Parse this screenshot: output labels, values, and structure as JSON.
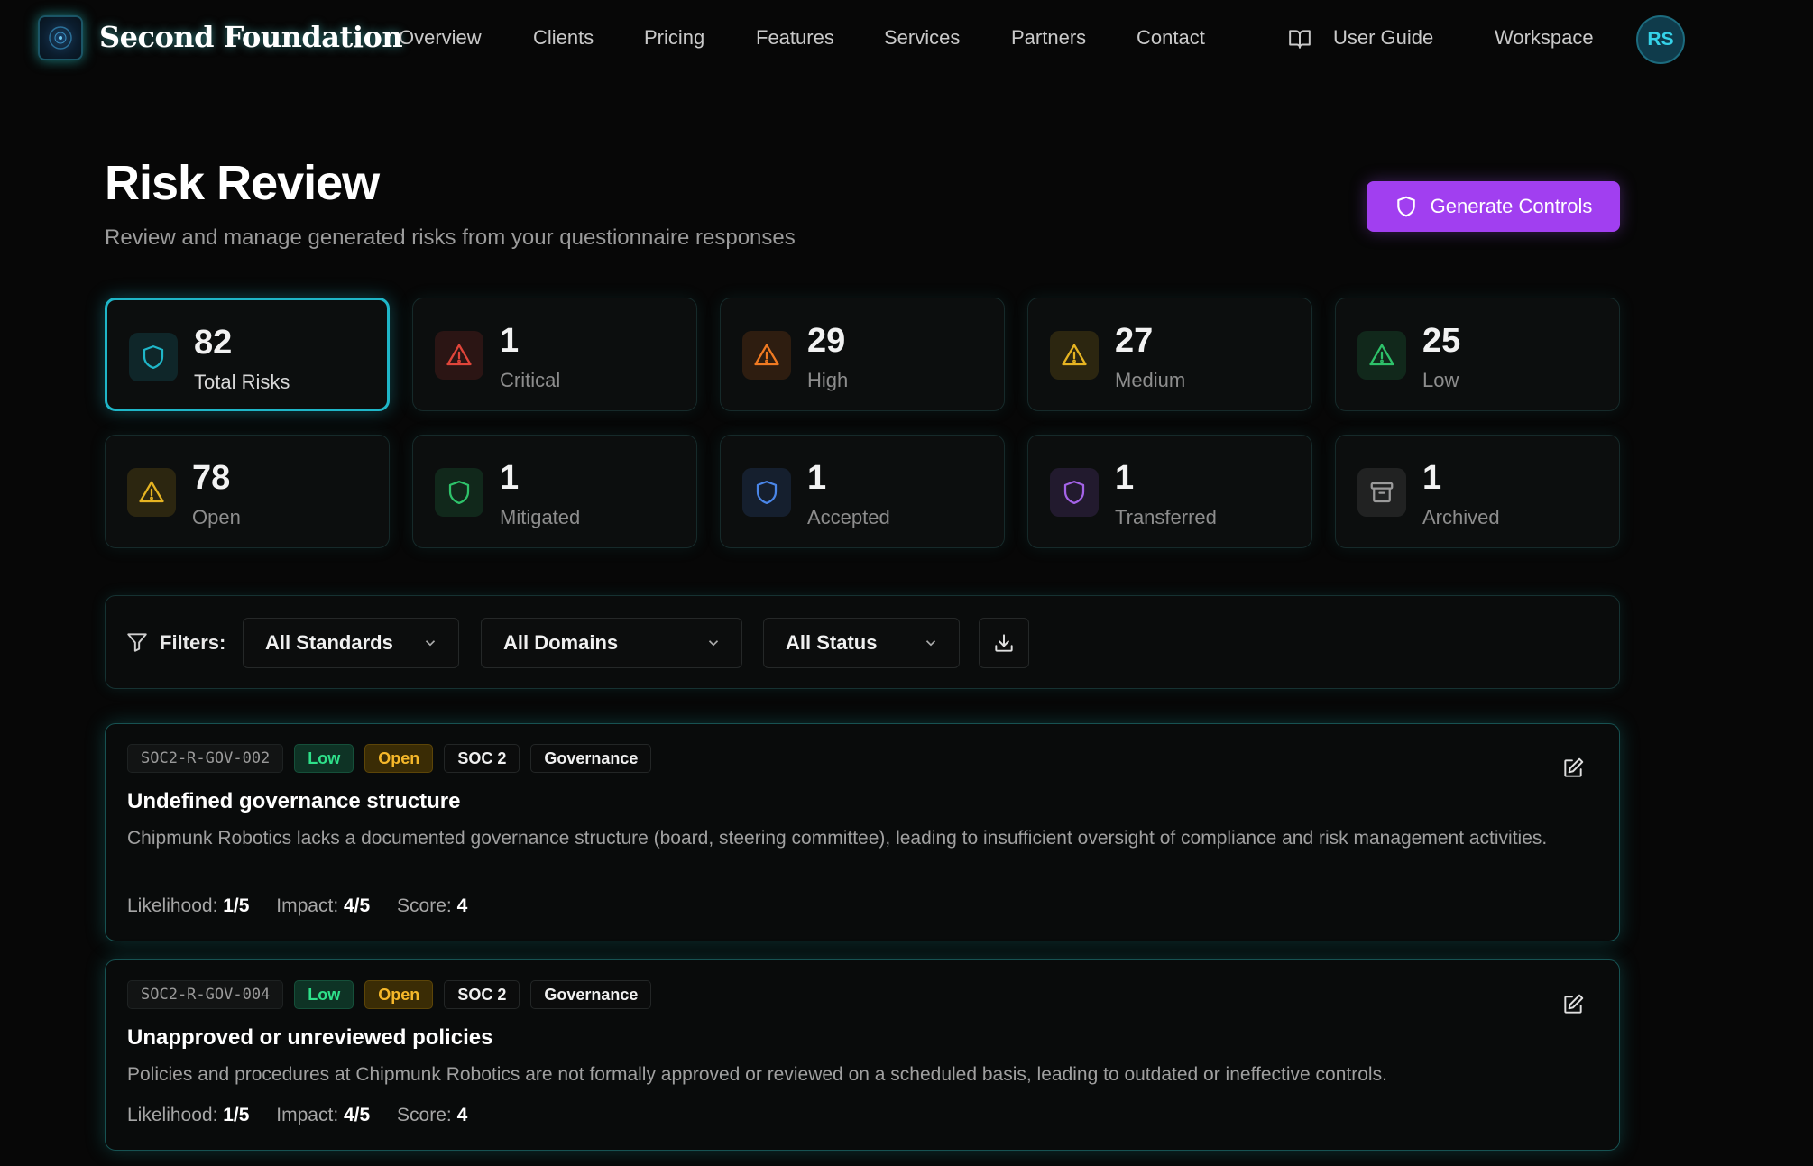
{
  "nav": {
    "brand": "Second Foundation",
    "links": [
      "Overview",
      "Clients",
      "Pricing",
      "Features",
      "Services",
      "Partners",
      "Contact"
    ],
    "user_guide": "User Guide",
    "workspace": "Workspace",
    "avatar_initials": "RS"
  },
  "header": {
    "title": "Risk Review",
    "subtitle": "Review and manage generated risks from your questionnaire responses",
    "generate_button": "Generate Controls"
  },
  "stats": [
    {
      "value": "82",
      "label": "Total Risks",
      "icon": "shield-icon",
      "color": "#1fb6c8"
    },
    {
      "value": "1",
      "label": "Critical",
      "icon": "warning-icon",
      "color": "#e0453a"
    },
    {
      "value": "29",
      "label": "High",
      "icon": "warning-icon",
      "color": "#f07a22"
    },
    {
      "value": "27",
      "label": "Medium",
      "icon": "warning-icon",
      "color": "#e6b422"
    },
    {
      "value": "25",
      "label": "Low",
      "icon": "warning-icon",
      "color": "#2ec26a"
    },
    {
      "value": "78",
      "label": "Open",
      "icon": "warning-icon",
      "color": "#e6b422"
    },
    {
      "value": "1",
      "label": "Mitigated",
      "icon": "shield-icon",
      "color": "#2ec26a"
    },
    {
      "value": "1",
      "label": "Accepted",
      "icon": "shield-icon",
      "color": "#4a86e8"
    },
    {
      "value": "1",
      "label": "Transferred",
      "icon": "shield-icon",
      "color": "#a463e8"
    },
    {
      "value": "1",
      "label": "Archived",
      "icon": "archive-icon",
      "color": "#9a9a9a"
    }
  ],
  "filters": {
    "label": "Filters:",
    "standards": "All Standards",
    "domains": "All Domains",
    "status": "All Status"
  },
  "risks": [
    {
      "id": "SOC2-R-GOV-002",
      "severity": "Low",
      "status": "Open",
      "standard": "SOC 2",
      "domain": "Governance",
      "title": "Undefined governance structure",
      "description": "Chipmunk Robotics lacks a documented governance structure (board, steering committee), leading to insufficient oversight of compliance and risk management activities.",
      "likelihood_label": "Likelihood:",
      "likelihood": "1/5",
      "impact_label": "Impact:",
      "impact": "4/5",
      "score_label": "Score:",
      "score": "4"
    },
    {
      "id": "SOC2-R-GOV-004",
      "severity": "Low",
      "status": "Open",
      "standard": "SOC 2",
      "domain": "Governance",
      "title": "Unapproved or unreviewed policies",
      "description": "Policies and procedures at Chipmunk Robotics are not formally approved or reviewed on a scheduled basis, leading to outdated or ineffective controls.",
      "likelihood_label": "Likelihood:",
      "likelihood": "1/5",
      "impact_label": "Impact:",
      "impact": "4/5",
      "score_label": "Score:",
      "score": "4"
    }
  ]
}
